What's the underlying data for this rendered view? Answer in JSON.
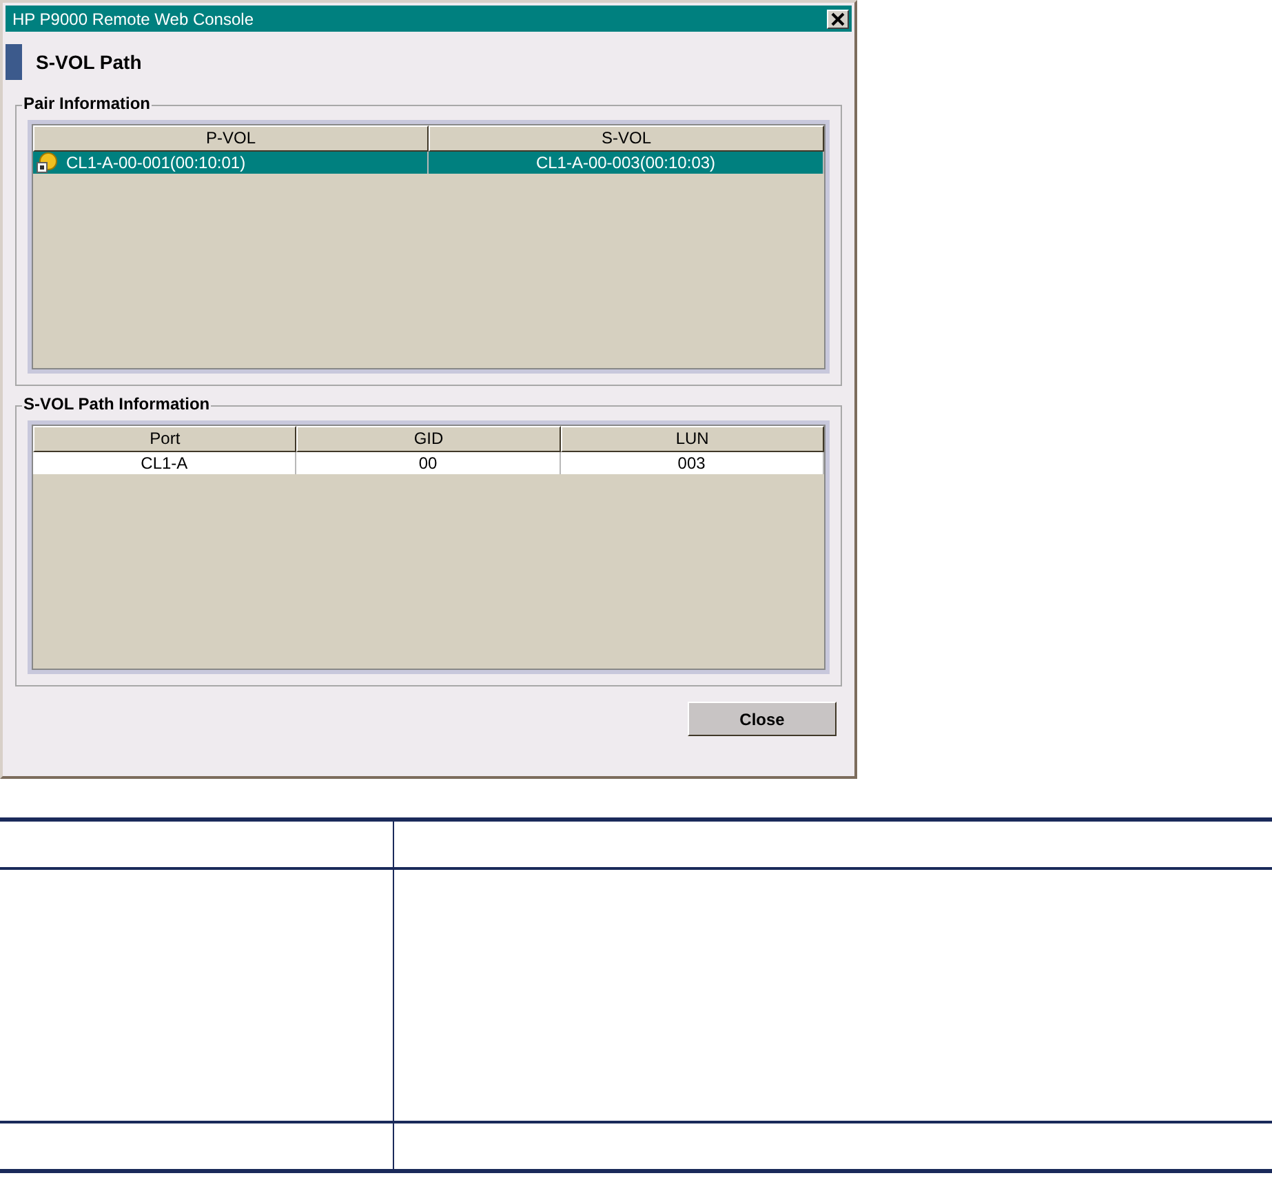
{
  "window": {
    "title": "HP P9000 Remote Web Console"
  },
  "header": {
    "title": "S-VOL Path"
  },
  "groups": [
    {
      "title": "Pair Information",
      "columns": [
        "P-VOL",
        "S-VOL"
      ],
      "rows": [
        {
          "cells": [
            "CL1-A-00-001(00:10:01)",
            "CL1-A-00-003(00:10:03)"
          ],
          "selected": true,
          "kind": "pair"
        }
      ]
    },
    {
      "title": "S-VOL Path Information",
      "columns": [
        "Port",
        "GID",
        "LUN"
      ],
      "rows": [
        {
          "cells": [
            "CL1-A",
            "00",
            "003"
          ],
          "selected": false,
          "kind": "plain"
        }
      ]
    }
  ],
  "buttons": [
    "Close"
  ]
}
